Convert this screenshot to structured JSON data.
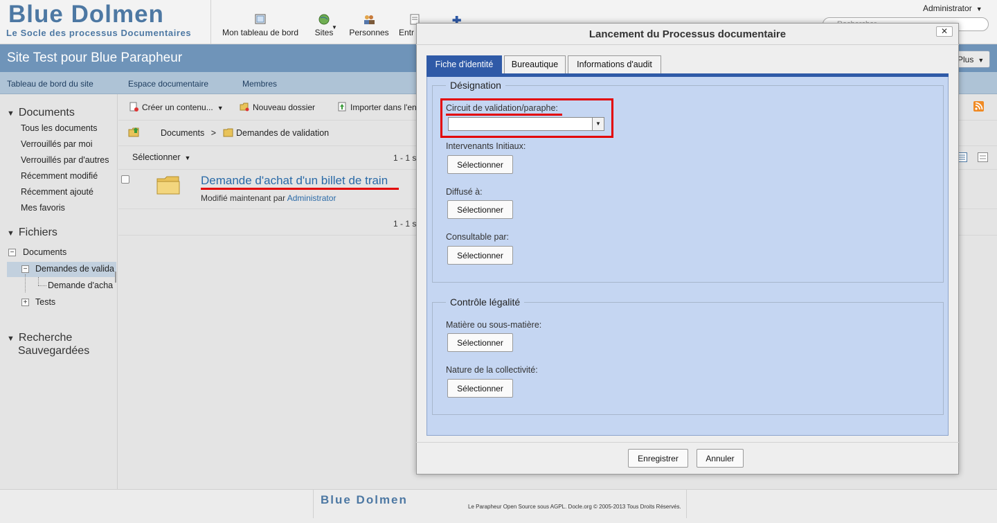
{
  "header": {
    "logo_title": "Blue Dolmen",
    "logo_subtitle": "Le Socle des processus Documentaires",
    "nav": {
      "dashboard": "Mon tableau de bord",
      "sites": "Sites",
      "people": "Personnes",
      "tasks": "Entr"
    },
    "user_menu": "Administrator",
    "search_placeholder": "Rechercher..."
  },
  "site": {
    "title": "Site Test pour Blue Parapheur",
    "more_button": "Plus",
    "nav": [
      "Tableau de bord du site",
      "Espace documentaire",
      "Membres"
    ]
  },
  "left_panel": {
    "documents_heading": "Documents",
    "document_filters": [
      "Tous les documents",
      "Verrouillés par moi",
      "Verrouillés par d'autres",
      "Récemment modifié",
      "Récemment ajouté",
      "Mes favoris"
    ],
    "files_heading": "Fichiers",
    "tree": {
      "root": "Documents",
      "selected": "Demandes de valida",
      "child": "Demande d'acha",
      "tests": "Tests"
    },
    "saved_searches_line1": "Recherche",
    "saved_searches_line2": "Sauvegardées"
  },
  "toolbar": {
    "create": "Créer un contenu...",
    "new_folder": "Nouveau dossier",
    "import": "Importer dans l'en"
  },
  "breadcrumb": {
    "root": "Documents",
    "separator": ">",
    "current": "Demandes de validation"
  },
  "list": {
    "select_label": "Sélectionner",
    "pager_top": "1 - 1 s",
    "pager_bottom": "1 - 1 s",
    "item": {
      "title": "Demande d'achat d'un billet de train",
      "meta_prefix": "Modifié maintenant par",
      "meta_user": "Administrator"
    }
  },
  "footer": {
    "logo": "Blue Dolmen",
    "text": "Le Parapheur Open Source sous AGPL. Docle.org © 2005-2013 Tous Droits Réservés."
  },
  "dialog": {
    "title": "Lancement du Processus documentaire",
    "close": "✕",
    "tabs": [
      "Fiche d'identité",
      "Bureautique",
      "Informations d'audit"
    ],
    "designation": {
      "legend": "Désignation",
      "circuit_label": "Circuit de validation/paraphe:",
      "circuit_value": "",
      "initial_label": "Intervenants Initiaux:",
      "diffuse_label": "Diffusé à:",
      "consult_label": "Consultable par:"
    },
    "legality": {
      "legend": "Contrôle légalité",
      "matter_label": "Matière ou sous-matière:",
      "nature_label": "Nature de la collectivité:"
    },
    "select_button": "Sélectionner",
    "save_button": "Enregistrer",
    "cancel_button": "Annuler"
  },
  "colors": {
    "accent": "#2f5aa7",
    "site_bar": "#6f94b9",
    "highlight": "#e30000",
    "form_bg": "#c5d6f2"
  }
}
